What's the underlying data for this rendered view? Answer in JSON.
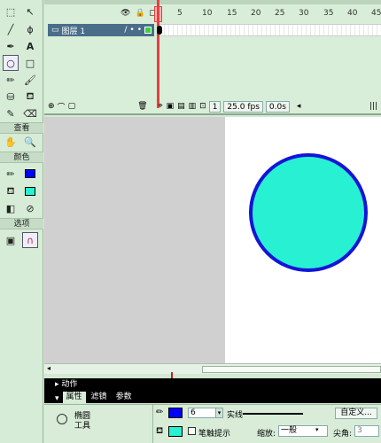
{
  "toolbox": {
    "section_view": "查看",
    "section_colors": "颜色",
    "section_options": "选项"
  },
  "timeline": {
    "frame_numbers": [
      "5",
      "10",
      "15",
      "20",
      "25",
      "30",
      "35",
      "40",
      "45"
    ],
    "layer_name": "图层 1",
    "current_frame": "1",
    "fps": "25.0 fps",
    "elapsed_time": "0.0s"
  },
  "stage": {
    "shape_fill_color": "#28f0d2",
    "shape_stroke_color": "#1414d8"
  },
  "panels": {
    "actions_label": "动作",
    "tabs": [
      "属性",
      "滤镜",
      "参数"
    ],
    "tool_name_line1": "椭圆",
    "tool_name_line2": "工具",
    "stroke_height": "6",
    "stroke_style": "实线",
    "custom_button": "自定义...",
    "stroke_hinting": "笔触提示",
    "scale_label": "缩放:",
    "scale_value": "一般",
    "cap_label": "尖角:",
    "cap_value": "3"
  }
}
